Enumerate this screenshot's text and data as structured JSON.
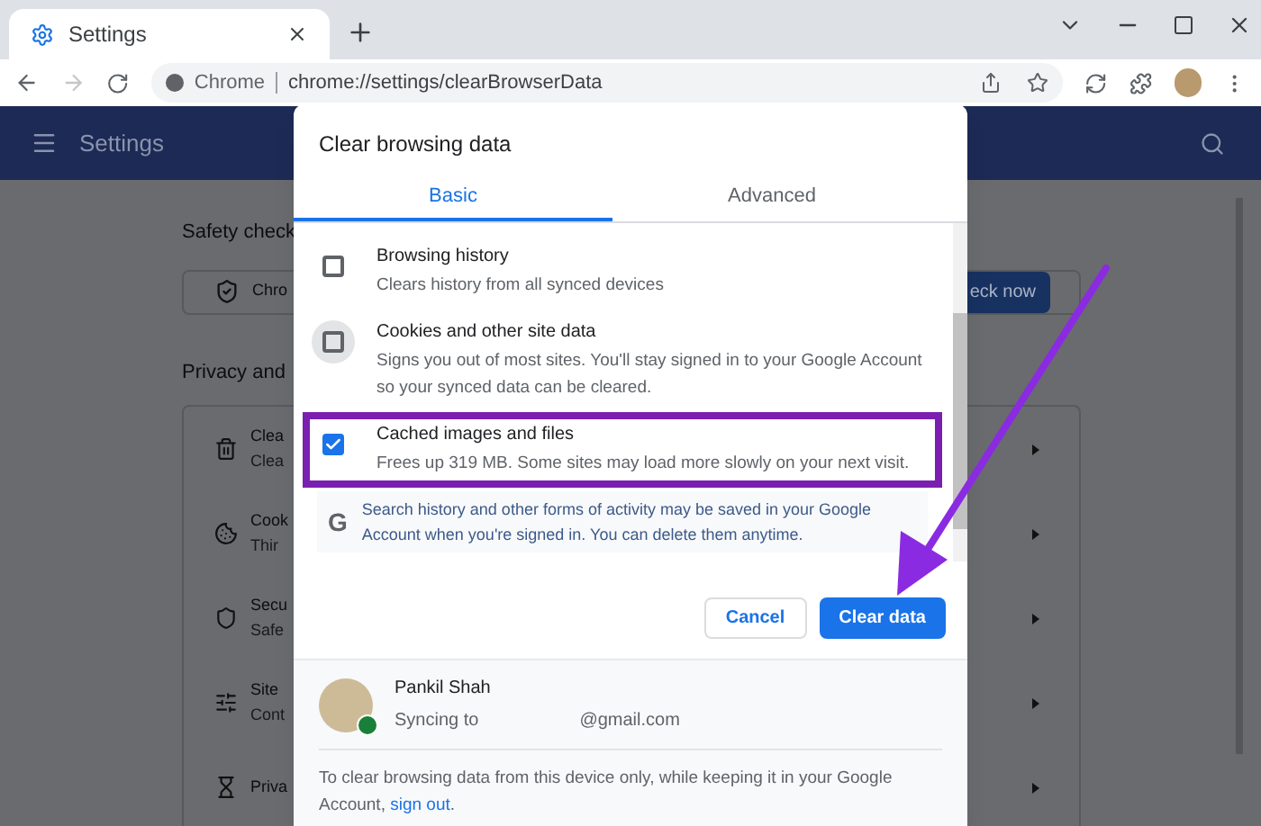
{
  "browser": {
    "tabs": [
      {
        "title": "Settings",
        "selected": true
      }
    ],
    "site_label": "Chrome",
    "url": "chrome://settings/clearBrowserData"
  },
  "settings_header": {
    "title": "Settings"
  },
  "background": {
    "safety_check": {
      "title": "Safety check",
      "row_text": "Chro",
      "button": "eck now"
    },
    "privacy": {
      "title": "Privacy and",
      "rows": [
        {
          "title": "Clea",
          "subtitle": "Clea"
        },
        {
          "title": "Cook",
          "subtitle": "Thir"
        },
        {
          "title": "Secu",
          "subtitle": "Safe"
        },
        {
          "title": "Site",
          "subtitle": "Cont"
        },
        {
          "title": "Priva"
        }
      ]
    }
  },
  "dialog": {
    "title": "Clear browsing data",
    "tabs": [
      {
        "label": "Basic",
        "selected": true
      },
      {
        "label": "Advanced",
        "selected": false
      }
    ],
    "options": [
      {
        "title": "Browsing history",
        "description": "Clears history from all synced devices",
        "checked": false,
        "focused": false,
        "highlighted": false
      },
      {
        "title": "Cookies and other site data",
        "description": "Signs you out of most sites. You'll stay signed in to your Google Account so your synced data can be cleared.",
        "checked": false,
        "focused": true,
        "highlighted": false
      },
      {
        "title": "Cached images and files",
        "description": "Frees up 319 MB. Some sites may load more slowly on your next visit.",
        "checked": true,
        "focused": false,
        "highlighted": true
      }
    ],
    "notice": {
      "icon_letter": "G",
      "text": "Search history and other forms of activity may be saved in your Google Account when you're signed in. You can delete them anytime."
    },
    "buttons": [
      {
        "label": "Cancel",
        "kind": "secondary"
      },
      {
        "label": "Clear data",
        "kind": "primary"
      }
    ],
    "account": {
      "name": "Pankil Shah",
      "syncing": "Syncing to",
      "email": "@gmail.com"
    },
    "footer": {
      "text": "To clear browsing data from this device only, while keeping it in your Google Account, ",
      "link": "sign out",
      "end": "."
    }
  }
}
